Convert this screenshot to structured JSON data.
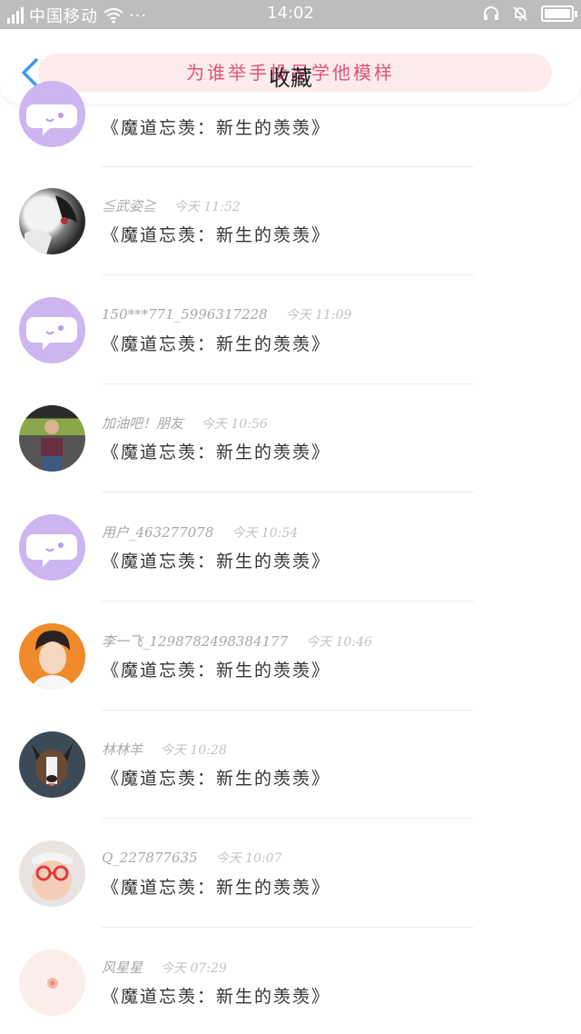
{
  "status_bar": {
    "carrier": "中国移动",
    "time": "14:02",
    "more": "···"
  },
  "header": {
    "title": "收藏",
    "watermark": "为谁举手投足学他模样",
    "back_icon": "chevron-left-icon"
  },
  "items": [
    {
      "user": "",
      "time": "",
      "title": "《魔道忘羡：新生的羡羡》",
      "avatar": "default-chat-avatar"
    },
    {
      "user": "≦武姿≧",
      "time": "今天 11:52",
      "title": "《魔道忘羡：新生的羡羡》",
      "avatar": "anime-avatar"
    },
    {
      "user": "150***771_5996317228",
      "time": "今天 11:09",
      "title": "《魔道忘羡：新生的羡羡》",
      "avatar": "default-chat-avatar"
    },
    {
      "user": "加油吧！朋友",
      "time": "今天 10:56",
      "title": "《魔道忘羡：新生的羡羡》",
      "avatar": "photo-avatar"
    },
    {
      "user": "用户_463277078",
      "time": "今天 10:54",
      "title": "《魔道忘羡：新生的羡羡》",
      "avatar": "default-chat-avatar"
    },
    {
      "user": "李一飞_1298782498384177",
      "time": "今天 10:46",
      "title": "《魔道忘羡：新生的羡羡》",
      "avatar": "portrait-avatar"
    },
    {
      "user": "林林羊",
      "time": "今天 10:28",
      "title": "《魔道忘羡：新生的羡羡》",
      "avatar": "dog-avatar"
    },
    {
      "user": "Q_227877635",
      "time": "今天 10:07",
      "title": "《魔道忘羡：新生的羡羡》",
      "avatar": "kid-glasses-avatar"
    },
    {
      "user": "风星星",
      "time": "今天 07:29",
      "title": "《魔道忘羡：新生的羡羡》",
      "avatar": "pink-flower-avatar"
    }
  ],
  "colors": {
    "status_bar": "#bdbdbd",
    "accent": "#3b9cf0",
    "default_avatar": "#cdb6ef",
    "watermark": "#e0557a"
  }
}
